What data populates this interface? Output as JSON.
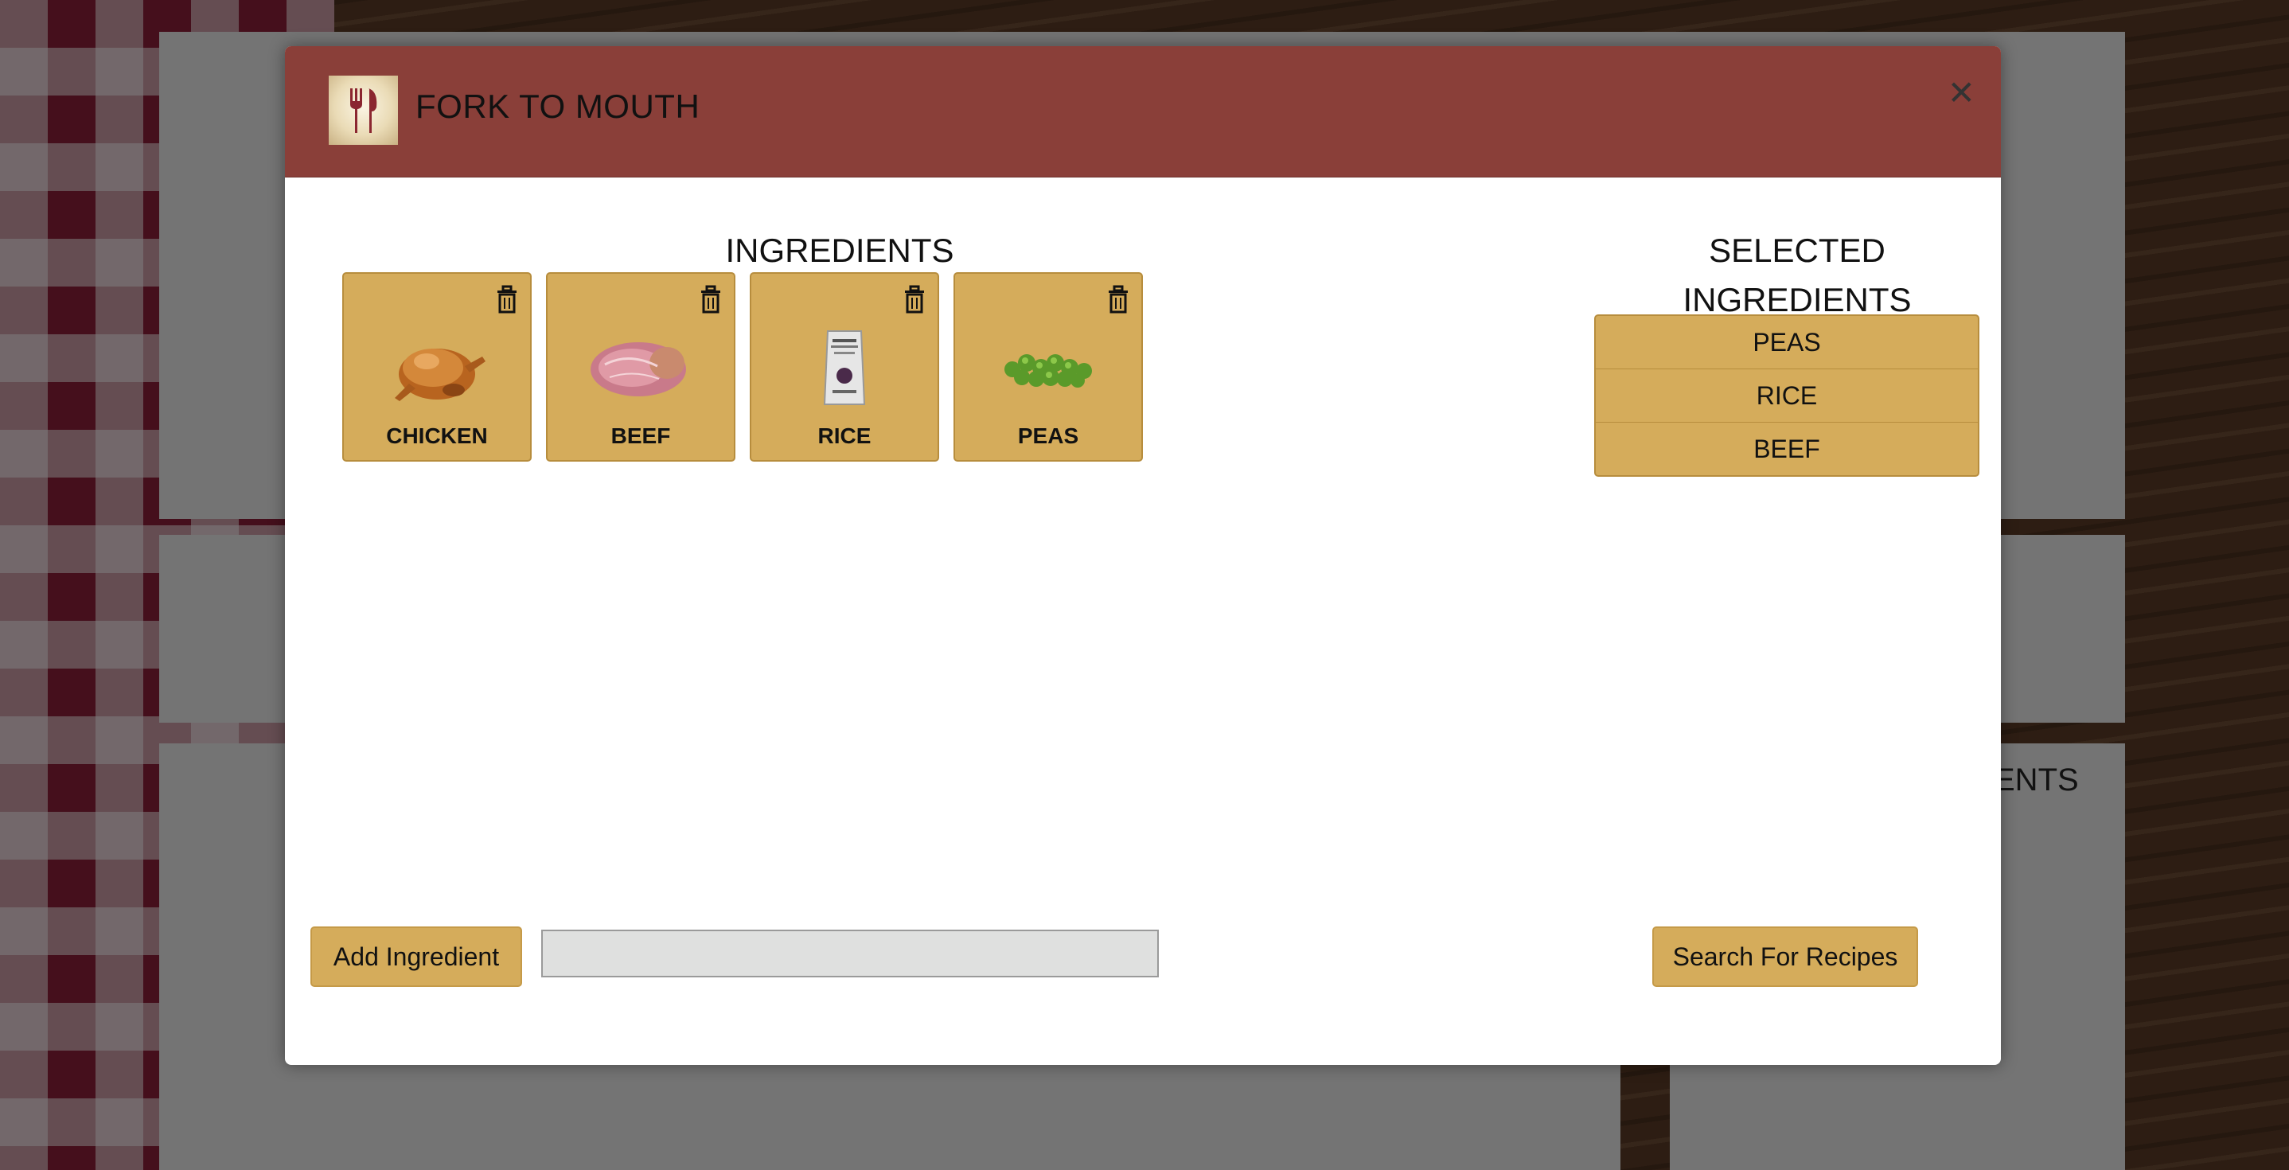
{
  "app": {
    "brand": "FORK TO MOUTH"
  },
  "background": {
    "partial_heading": "ENTS"
  },
  "ingredients": {
    "title": "INGREDIENTS",
    "items": [
      {
        "name": "CHICKEN",
        "icon": "chicken-image"
      },
      {
        "name": "BEEF",
        "icon": "beef-image"
      },
      {
        "name": "RICE",
        "icon": "rice-bag-image"
      },
      {
        "name": "PEAS",
        "icon": "peas-image"
      }
    ]
  },
  "selected": {
    "title_line1": "SELECTED",
    "title_line2": "INGREDIENTS",
    "items": [
      "PEAS",
      "RICE",
      "BEEF"
    ]
  },
  "actions": {
    "add_label": "Add Ingredient",
    "input_value": "",
    "search_label": "Search For Recipes"
  },
  "colors": {
    "header": "#8a3f39",
    "card": "#d5ac5b",
    "card_border": "#b78d3d"
  }
}
